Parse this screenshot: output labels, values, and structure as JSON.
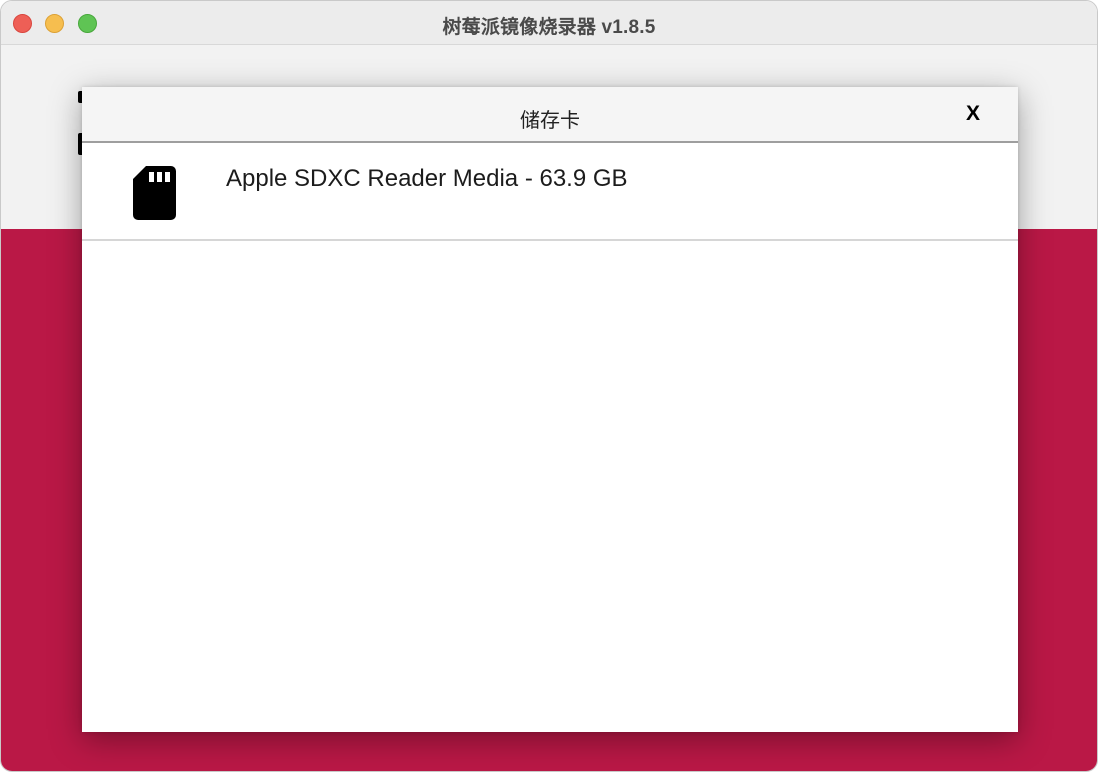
{
  "window": {
    "title": "树莓派镜像烧录器 v1.8.5"
  },
  "dialog": {
    "title": "储存卡",
    "close_label": "X"
  },
  "storage_list": {
    "items": [
      {
        "label": "Apple SDXC Reader Media - 63.9 GB",
        "icon": "sd-card-icon"
      }
    ]
  },
  "colors": {
    "accent": "#c51a4a",
    "titlebar": "#ececec"
  }
}
